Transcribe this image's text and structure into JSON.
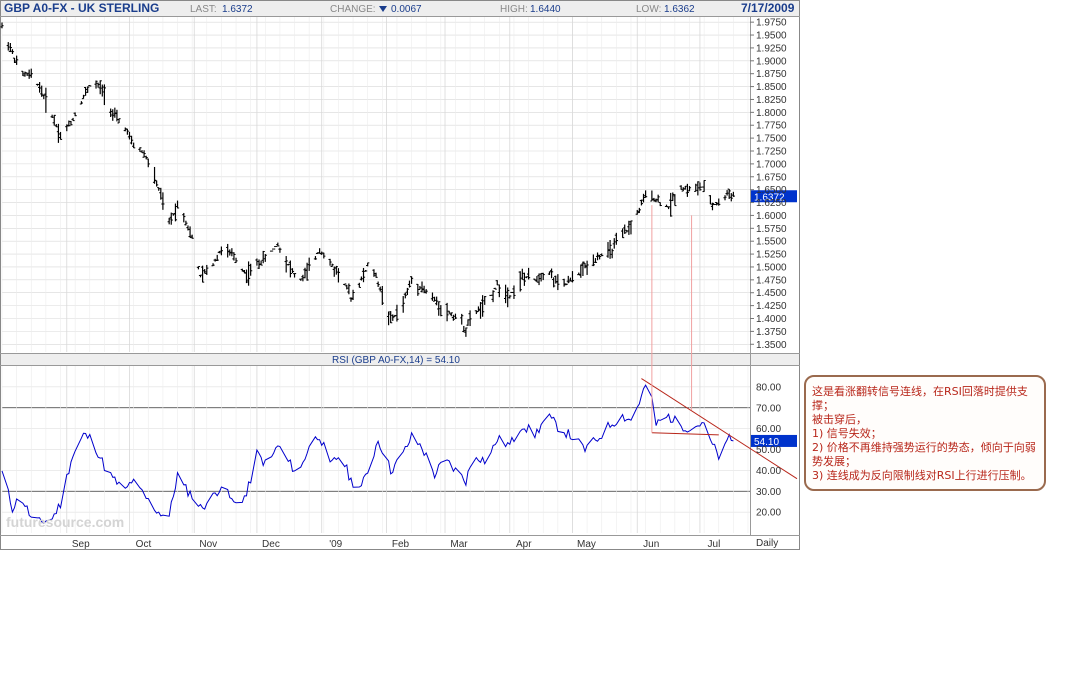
{
  "header": {
    "symbol": "GBP A0-FX - UK STERLING",
    "last_label": "LAST:",
    "last_value": "1.6372",
    "change_label": "CHANGE:",
    "change_value": "0.0067",
    "high_label": "HIGH:",
    "high_value": "1.6440",
    "low_label": "LOW:",
    "low_value": "1.6362",
    "date": "7/17/2009"
  },
  "watermark": "futuresource.com",
  "period_label": "Daily",
  "colors": {
    "price": "#000000",
    "rsi_line": "#0000cc",
    "label_bg": "#0033cc",
    "annotation": "#b8261a",
    "grid": "#d8d8d8"
  },
  "chart_data": [
    {
      "type": "line",
      "name": "price",
      "title": "GBP A0-FX - UK STERLING",
      "style": "ohlc-bars",
      "ylim": [
        1.335,
        1.985
      ],
      "y_ticks": [
        "1.9750",
        "1.9500",
        "1.9250",
        "1.9000",
        "1.8750",
        "1.8500",
        "1.8250",
        "1.8000",
        "1.7750",
        "1.7500",
        "1.7250",
        "1.7000",
        "1.6750",
        "1.6500",
        "1.6250",
        "1.6000",
        "1.5750",
        "1.5500",
        "1.5250",
        "1.5000",
        "1.4750",
        "1.4500",
        "1.4250",
        "1.4000",
        "1.3750",
        "1.3500"
      ],
      "x_ticks": [
        "Sep",
        "Oct",
        "Nov",
        "Dec",
        "'09",
        "Feb",
        "Mar",
        "Apr",
        "May",
        "Jun",
        "Jul"
      ],
      "x_range": [
        "2008-08-01",
        "2009-07-24"
      ],
      "last_value_label": "1.6372",
      "series": [
        {
          "x": [
            "2008-08-01",
            "2008-08-06",
            "2008-08-10",
            "2008-08-15",
            "2008-08-19",
            "2008-08-25",
            "2008-08-29",
            "2008-09-03",
            "2008-09-09",
            "2008-09-13",
            "2008-09-19",
            "2008-09-23",
            "2008-09-29",
            "2008-10-02",
            "2008-10-08",
            "2008-10-11",
            "2008-10-15",
            "2008-10-20",
            "2008-10-24",
            "2008-10-27",
            "2008-10-31",
            "2008-11-04",
            "2008-11-09",
            "2008-11-14",
            "2008-11-20",
            "2008-11-26",
            "2008-12-01",
            "2008-12-06",
            "2008-12-11",
            "2008-12-16",
            "2008-12-21",
            "2008-12-26",
            "2008-12-31",
            "2009-01-05",
            "2009-01-10",
            "2009-01-15",
            "2009-01-20",
            "2009-01-24",
            "2009-01-28",
            "2009-02-03",
            "2009-02-08",
            "2009-02-13",
            "2009-02-18",
            "2009-02-24",
            "2009-03-01",
            "2009-03-06",
            "2009-03-11",
            "2009-03-15",
            "2009-03-21",
            "2009-03-26",
            "2009-04-01",
            "2009-04-07",
            "2009-04-13",
            "2009-04-19",
            "2009-04-25",
            "2009-05-01",
            "2009-05-07",
            "2009-05-13",
            "2009-05-19",
            "2009-05-25",
            "2009-05-29",
            "2009-06-03",
            "2009-06-06",
            "2009-06-10",
            "2009-06-16",
            "2009-06-21",
            "2009-06-27",
            "2009-07-02",
            "2009-07-07",
            "2009-07-11",
            "2009-07-15",
            "2009-07-17"
          ],
          "y": [
            1.965,
            1.915,
            1.875,
            1.87,
            1.85,
            1.795,
            1.755,
            1.78,
            1.83,
            1.86,
            1.84,
            1.795,
            1.77,
            1.74,
            1.72,
            1.695,
            1.65,
            1.585,
            1.62,
            1.6,
            1.555,
            1.48,
            1.5,
            1.535,
            1.52,
            1.485,
            1.505,
            1.52,
            1.545,
            1.505,
            1.47,
            1.495,
            1.535,
            1.505,
            1.485,
            1.44,
            1.475,
            1.51,
            1.47,
            1.395,
            1.42,
            1.475,
            1.46,
            1.435,
            1.415,
            1.405,
            1.38,
            1.41,
            1.43,
            1.465,
            1.445,
            1.48,
            1.475,
            1.495,
            1.46,
            1.475,
            1.5,
            1.52,
            1.53,
            1.56,
            1.58,
            1.62,
            1.645,
            1.63,
            1.615,
            1.655,
            1.65,
            1.655,
            1.62,
            1.625,
            1.645,
            1.6372
          ]
        }
      ]
    },
    {
      "type": "line",
      "name": "RSI",
      "title": "RSI (GBP A0-FX,14) = 54.10",
      "ylim": [
        10,
        90
      ],
      "y_ticks": [
        "80.00",
        "70.00",
        "60.00",
        "50.00",
        "40.00",
        "30.00",
        "20.00"
      ],
      "reference_lines": [
        70,
        30
      ],
      "last_value_label": "54.10",
      "series": [
        {
          "x": [
            "2008-08-01",
            "2008-08-06",
            "2008-08-10",
            "2008-08-15",
            "2008-08-19",
            "2008-08-25",
            "2008-08-29",
            "2008-09-03",
            "2008-09-09",
            "2008-09-13",
            "2008-09-19",
            "2008-09-23",
            "2008-09-29",
            "2008-10-02",
            "2008-10-08",
            "2008-10-11",
            "2008-10-15",
            "2008-10-20",
            "2008-10-24",
            "2008-10-27",
            "2008-10-31",
            "2008-11-04",
            "2008-11-09",
            "2008-11-14",
            "2008-11-20",
            "2008-11-26",
            "2008-12-01",
            "2008-12-06",
            "2008-12-11",
            "2008-12-16",
            "2008-12-21",
            "2008-12-26",
            "2008-12-31",
            "2009-01-05",
            "2009-01-10",
            "2009-01-15",
            "2009-01-20",
            "2009-01-24",
            "2009-01-28",
            "2009-02-03",
            "2009-02-08",
            "2009-02-13",
            "2009-02-18",
            "2009-02-24",
            "2009-03-01",
            "2009-03-06",
            "2009-03-11",
            "2009-03-15",
            "2009-03-21",
            "2009-03-26",
            "2009-04-01",
            "2009-04-07",
            "2009-04-13",
            "2009-04-19",
            "2009-04-25",
            "2009-05-01",
            "2009-05-07",
            "2009-05-13",
            "2009-05-19",
            "2009-05-25",
            "2009-05-29",
            "2009-06-03",
            "2009-06-06",
            "2009-06-10",
            "2009-06-16",
            "2009-06-21",
            "2009-06-27",
            "2009-07-02",
            "2009-07-07",
            "2009-07-11",
            "2009-07-15",
            "2009-07-17"
          ],
          "y": [
            39,
            22,
            28,
            17,
            15,
            17,
            24,
            45,
            57,
            55,
            42,
            36,
            30,
            35,
            28,
            24,
            20,
            18,
            38,
            32,
            28,
            22,
            26,
            33,
            24,
            28,
            48,
            42,
            52,
            44,
            38,
            52,
            57,
            42,
            48,
            35,
            32,
            42,
            55,
            40,
            46,
            56,
            51,
            38,
            45,
            40,
            35,
            48,
            44,
            55,
            52,
            62,
            57,
            66,
            60,
            56,
            50,
            55,
            62,
            66,
            64,
            75,
            84,
            62,
            66,
            62,
            60,
            63,
            52,
            45,
            56,
            54.1
          ]
        }
      ]
    }
  ],
  "annotation": {
    "line1": "这是看涨翻转信号连线，在RSI回落时提供支撑；",
    "line2": "被击穿后，",
    "line3": "1) 信号失效；",
    "line4": "2) 价格不再维持强势运行的势态，倾向于向弱势发展；",
    "line5": "3) 连线成为反向限制线对RSI上行进行压制。"
  }
}
